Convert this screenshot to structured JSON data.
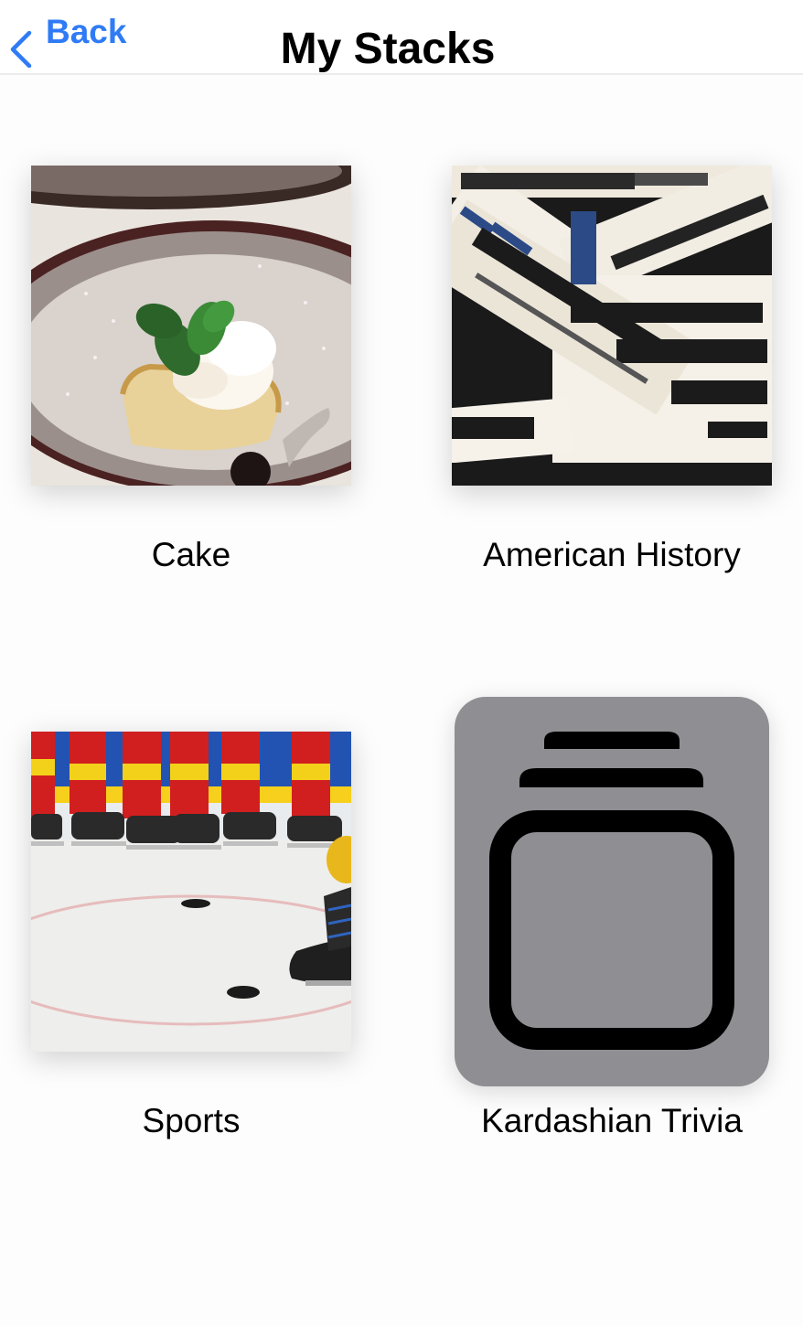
{
  "navbar": {
    "back_label": "Back",
    "title": "My Stacks",
    "accent_color": "#2f7bf6"
  },
  "stacks": [
    {
      "label": "Cake",
      "thumbnail": "cake-dessert-photo"
    },
    {
      "label": "American History",
      "thumbnail": "newspaper-clippings-photo"
    },
    {
      "label": "Sports",
      "thumbnail": "ice-hockey-photo"
    },
    {
      "label": "Kardashian Trivia",
      "thumbnail": "stack-placeholder-icon"
    }
  ]
}
